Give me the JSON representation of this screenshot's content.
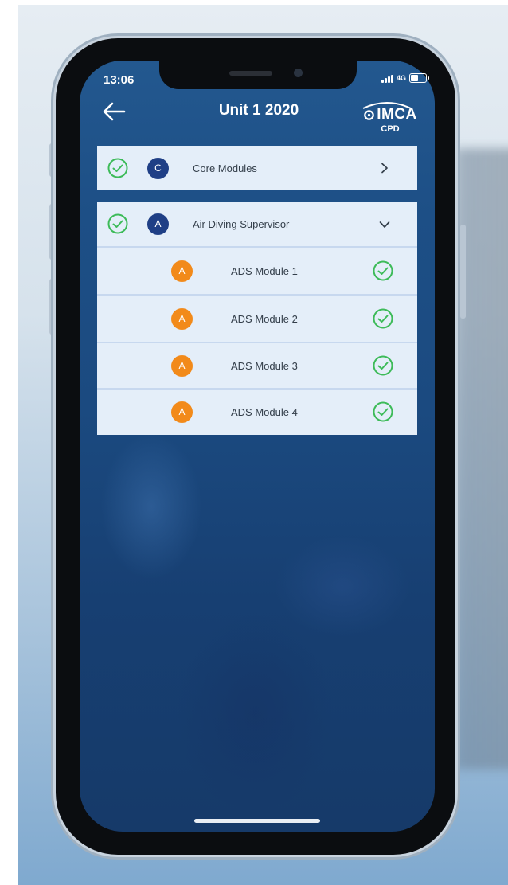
{
  "status_bar": {
    "time": "13:06",
    "network": "4G"
  },
  "header": {
    "title": "Unit 1 2020"
  },
  "logo": {
    "brand": "IMCA",
    "sub": "CPD"
  },
  "list": {
    "core": {
      "badge": "C",
      "label": "Core Modules",
      "completed": true,
      "expanded": false
    },
    "ads": {
      "badge": "A",
      "label": "Air Diving Supervisor",
      "completed": true,
      "expanded": true,
      "modules": [
        {
          "badge": "A",
          "label": "ADS Module 1",
          "completed": true
        },
        {
          "badge": "A",
          "label": "ADS Module 2",
          "completed": true
        },
        {
          "badge": "A",
          "label": "ADS Module 3",
          "completed": true
        },
        {
          "badge": "A",
          "label": "ADS Module 4",
          "completed": true
        }
      ]
    }
  },
  "colors": {
    "accent_green": "#3dbb59",
    "badge_navy": "#1f3f86",
    "badge_orange": "#f28a1a",
    "row_bg": "#e4eef9",
    "screen_bg": "#1d4f86"
  },
  "icons": {
    "back": "arrow-left-icon",
    "core_toggle": "chevron-right-icon",
    "ads_toggle": "chevron-down-icon",
    "complete": "check-circle-icon"
  }
}
